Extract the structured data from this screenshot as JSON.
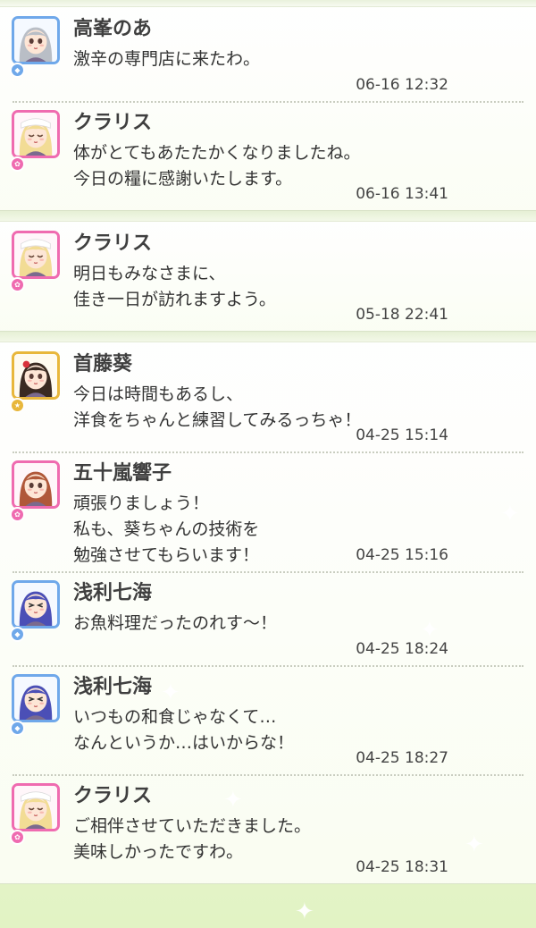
{
  "groups": [
    {
      "messages": [
        {
          "name": "高峯のあ",
          "avatar": "noa-avatar",
          "color": "blue",
          "lines": [
            "激辛の専門店に来たわ。"
          ],
          "time": "06-16 12:32"
        },
        {
          "name": "クラリス",
          "avatar": "clarice-avatar",
          "color": "pink",
          "lines": [
            "体がとてもあたたかくなりましたね。",
            "今日の糧に感謝いたします。"
          ],
          "time": "06-16 13:41"
        }
      ]
    },
    {
      "messages": [
        {
          "name": "クラリス",
          "avatar": "clarice-avatar",
          "color": "pink",
          "lines": [
            "明日もみなさまに、",
            "佳き一日が訪れますよう。"
          ],
          "time": "05-18 22:41"
        }
      ]
    },
    {
      "messages": [
        {
          "name": "首藤葵",
          "avatar": "aoi-avatar",
          "color": "gold",
          "lines": [
            "今日は時間もあるし、",
            "洋食をちゃんと練習してみるっちゃ！"
          ],
          "time": "04-25 15:14"
        },
        {
          "name": "五十嵐響子",
          "avatar": "kyoko-avatar",
          "color": "pink",
          "lines": [
            "頑張りましょう！",
            "私も、葵ちゃんの技術を",
            "勉強させてもらいます！"
          ],
          "time": "04-25 15:16"
        },
        {
          "name": "浅利七海",
          "avatar": "nanami-avatar",
          "color": "blue",
          "lines": [
            "お魚料理だったのれす～！"
          ],
          "time": "04-25 18:24"
        },
        {
          "name": "浅利七海",
          "avatar": "nanami-avatar",
          "color": "blue",
          "lines": [
            "いつもの和食じゃなくて…",
            "なんというか…はいからな！"
          ],
          "time": "04-25 18:27"
        },
        {
          "name": "クラリス",
          "avatar": "clarice-avatar",
          "color": "pink",
          "lines": [
            "ご相伴させていただきました。",
            "美味しかったですわ。"
          ],
          "time": "04-25 18:31"
        }
      ]
    }
  ],
  "colors": {
    "blue": "#6fa8ea",
    "pink": "#ef6bb0",
    "gold": "#e8b73c"
  }
}
